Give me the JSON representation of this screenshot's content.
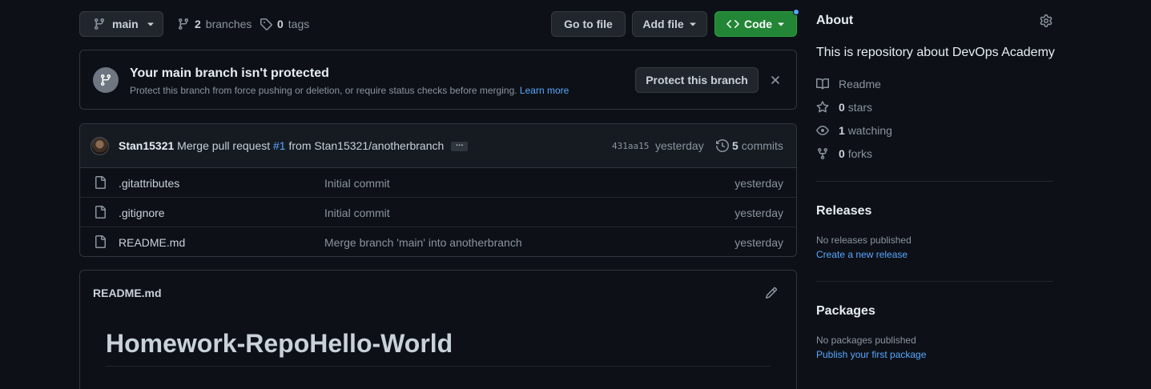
{
  "topbar": {
    "branch": "main",
    "branches_count": "2",
    "branches_label": "branches",
    "tags_count": "0",
    "tags_label": "tags",
    "go_to_file": "Go to file",
    "add_file": "Add file",
    "code": "Code"
  },
  "banner": {
    "title": "Your main branch isn't protected",
    "description": "Protect this branch from force pushing or deletion, or require status checks before merging.",
    "learn_more": "Learn more",
    "protect_button": "Protect this branch"
  },
  "commit": {
    "author": "Stan15321",
    "message_prefix": "Merge pull request",
    "pr_number": "#1",
    "message_suffix": "from Stan15321/anotherbranch",
    "ellipsis": "…",
    "sha": "431aa15",
    "when": "yesterday",
    "count": "5",
    "count_label": "commits"
  },
  "files": [
    {
      "name": ".gitattributes",
      "message": "Initial commit",
      "when": "yesterday"
    },
    {
      "name": ".gitignore",
      "message": "Initial commit",
      "when": "yesterday"
    },
    {
      "name": "README.md",
      "message": "Merge branch 'main' into anotherbranch",
      "when": "yesterday"
    }
  ],
  "readme": {
    "filename": "README.md",
    "heading": "Homework-RepoHello-World"
  },
  "about": {
    "title": "About",
    "description": "This is repository about DevOps Academy",
    "readme_label": "Readme",
    "stars_count": "0",
    "stars_label": "stars",
    "watching_count": "1",
    "watching_label": "watching",
    "forks_count": "0",
    "forks_label": "forks"
  },
  "releases": {
    "title": "Releases",
    "empty": "No releases published",
    "link": "Create a new release"
  },
  "packages": {
    "title": "Packages",
    "empty": "No packages published",
    "link": "Publish your first package"
  },
  "colors": {
    "background": "#0d1117",
    "accent_link": "#58a6ff",
    "code_button": "#238636"
  }
}
